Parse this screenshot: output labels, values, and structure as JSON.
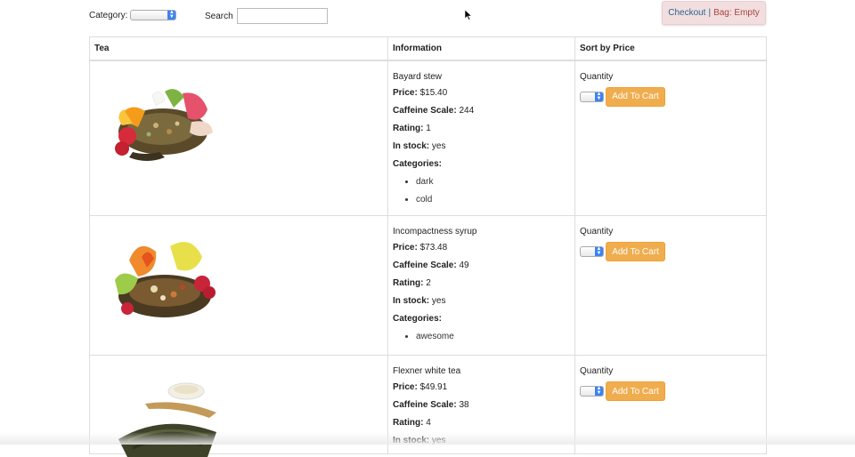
{
  "filters": {
    "category_label": "Category:",
    "search_label": "Search",
    "search_value": "",
    "search_placeholder": ""
  },
  "checkout": {
    "link_label": "Checkout",
    "separator": "|",
    "bag_label": "Bag: Empty"
  },
  "table": {
    "headers": [
      "Tea",
      "Information",
      "Sort by Price"
    ],
    "labels": {
      "price": "Price:",
      "caffeine": "Caffeine Scale:",
      "rating": "Rating:",
      "stock": "In stock:",
      "categories": "Categories:",
      "quantity": "Quantity",
      "add_to_cart": "Add To Cart"
    },
    "rows": [
      {
        "name": "Bayard stew",
        "price": "$15.40",
        "caffeine": "244",
        "rating": "1",
        "stock": "yes",
        "categories": [
          "dark",
          "cold"
        ],
        "image_icon": "fruit-tea-blend-image"
      },
      {
        "name": "Incompactness syrup",
        "price": "$73.48",
        "caffeine": "49",
        "rating": "2",
        "stock": "yes",
        "categories": [
          "awesome"
        ],
        "image_icon": "floral-berry-tea-image"
      },
      {
        "name": "Flexner white tea",
        "price": "$49.91",
        "caffeine": "38",
        "rating": "4",
        "stock": "yes",
        "categories": [],
        "image_icon": "loose-leaf-tea-image"
      }
    ]
  },
  "colors": {
    "button_orange": "#f0ad4e",
    "checkout_bg": "#f2dede",
    "link_blue": "#2a6496",
    "select_blue": "#3b82f6"
  }
}
